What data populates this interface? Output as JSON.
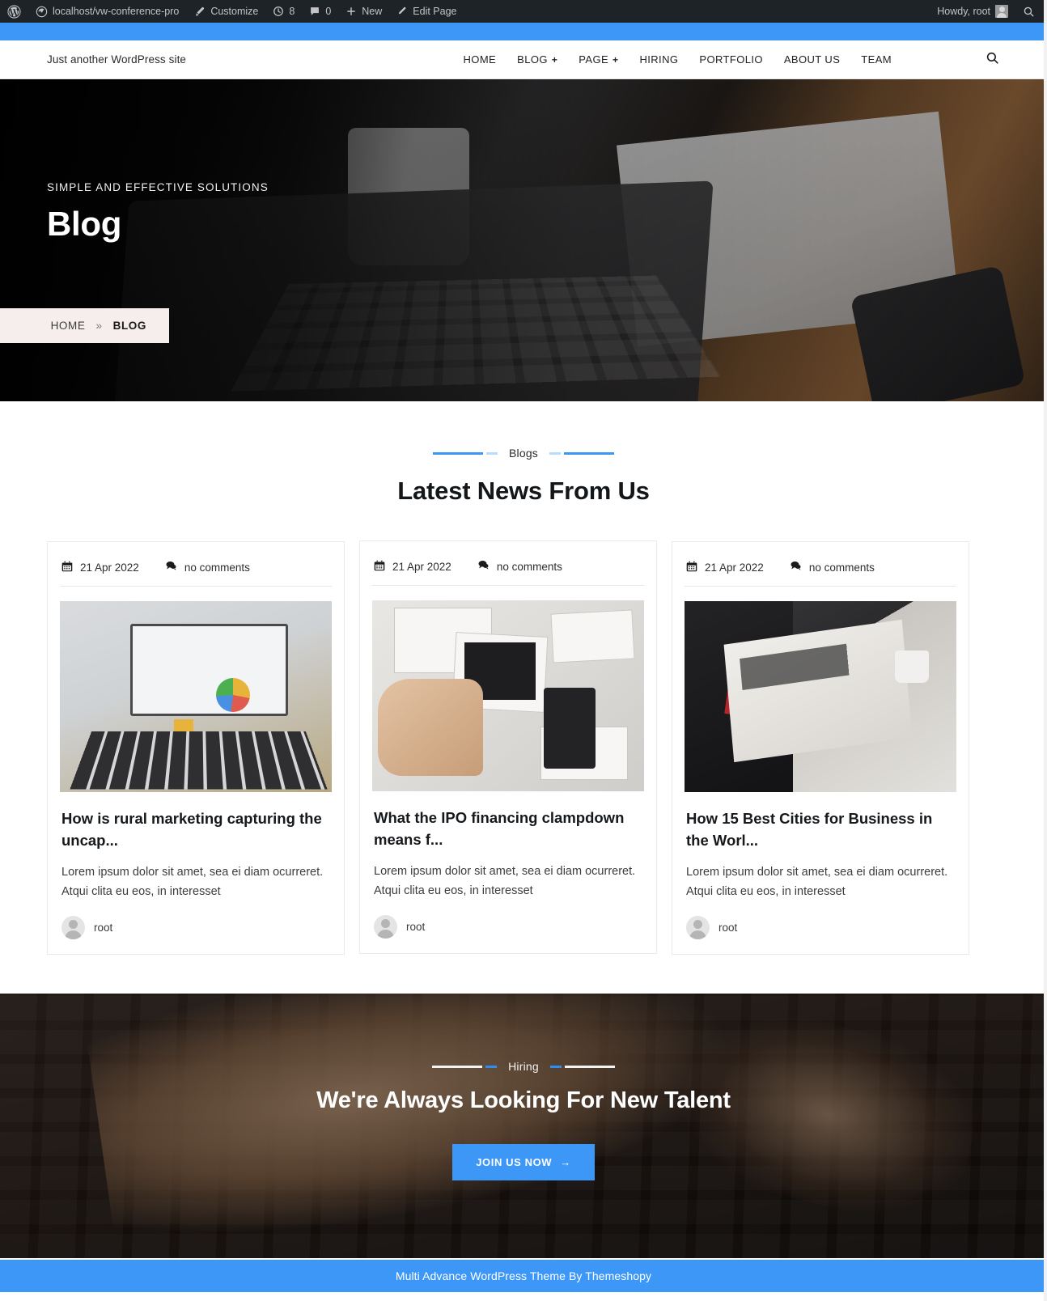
{
  "admin_bar": {
    "wp_logo": "wordpress-logo-icon",
    "site_name": "localhost/vw-conference-pro",
    "customize": "Customize",
    "updates_count": "8",
    "comments_count": "0",
    "new": "New",
    "edit_page": "Edit Page",
    "howdy": "Howdy, root",
    "search": "search-icon"
  },
  "header": {
    "tagline": "Just another WordPress site",
    "nav": [
      {
        "label": "HOME",
        "has_dropdown": false
      },
      {
        "label": "BLOG",
        "has_dropdown": true
      },
      {
        "label": "PAGE",
        "has_dropdown": true
      },
      {
        "label": "HIRING",
        "has_dropdown": false
      },
      {
        "label": "PORTFOLIO",
        "has_dropdown": false
      },
      {
        "label": "ABOUT US",
        "has_dropdown": false
      },
      {
        "label": "TEAM",
        "has_dropdown": false
      }
    ]
  },
  "hero": {
    "subtitle": "SIMPLE AND EFFECTIVE SOLUTIONS",
    "title": "Blog",
    "breadcrumb": {
      "home": "HOME",
      "separator": "»",
      "current": "BLOG"
    }
  },
  "blogs": {
    "eyebrow": "Blogs",
    "heading": "Latest News From Us",
    "posts": [
      {
        "date": "21 Apr 2022",
        "comments": "no comments",
        "title": "How is rural marketing capturing the uncap...",
        "excerpt": "Lorem ipsum dolor sit amet, sea ei diam ocurreret. Atqui clita eu eos, in interesset",
        "author": "root"
      },
      {
        "date": "21 Apr 2022",
        "comments": "no comments",
        "title": "What the IPO financing clampdown means f...",
        "excerpt": "Lorem ipsum dolor sit amet, sea ei diam ocurreret. Atqui clita eu eos, in interesset",
        "author": "root"
      },
      {
        "date": "21 Apr 2022",
        "comments": "no comments",
        "title": "How 15 Best Cities for Business in the Worl...",
        "excerpt": "Lorem ipsum dolor sit amet, sea ei diam ocurreret. Atqui clita eu eos, in interesset",
        "author": "root"
      }
    ]
  },
  "hiring": {
    "eyebrow": "Hiring",
    "heading": "We're Always Looking For New Talent",
    "cta_label": "JOIN US NOW",
    "cta_arrow": "→"
  },
  "footer": {
    "text": "Multi Advance WordPress Theme By Themeshopy"
  },
  "colors": {
    "accent": "#3d97f7",
    "adminbar": "#1d2327",
    "breadcrumb_bg": "#f6eeec"
  }
}
